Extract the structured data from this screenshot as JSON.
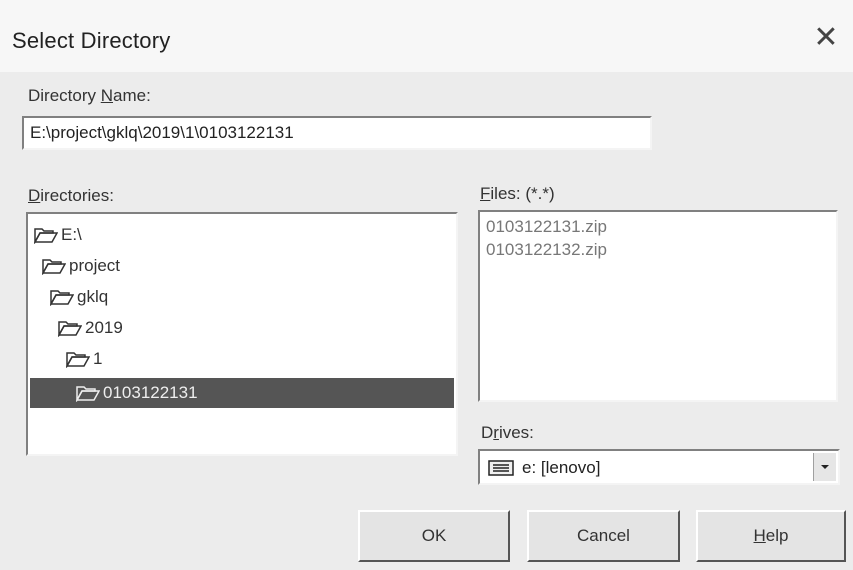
{
  "window": {
    "title": "Select Directory",
    "close_glyph": "✕"
  },
  "directory_name": {
    "label_prefix": "Directory ",
    "label_access": "N",
    "label_rest": "ame:",
    "value": "E:\\project\\gklq\\2019\\1\\0103122131"
  },
  "directories": {
    "label_access": "D",
    "label_rest": "irectories:",
    "items": [
      {
        "name": "E:\\",
        "icon": "folder-open-icon"
      },
      {
        "name": "project",
        "icon": "folder-open-icon"
      },
      {
        "name": "gklq",
        "icon": "folder-open-icon"
      },
      {
        "name": "2019",
        "icon": "folder-open-icon"
      },
      {
        "name": "1",
        "icon": "folder-open-icon"
      },
      {
        "name": "0103122131",
        "icon": "folder-open-icon",
        "selected": true
      }
    ]
  },
  "files": {
    "label_access": "F",
    "label_rest": "iles: (*.*)",
    "items": [
      "0103122131.zip",
      "0103122132.zip"
    ]
  },
  "drives": {
    "label_prefix": "D",
    "label_access": "r",
    "label_rest": "ives:",
    "selected": "e: [lenovo]",
    "icon": "drive-icon"
  },
  "buttons": {
    "ok": "OK",
    "cancel": "Cancel",
    "help_access": "H",
    "help_rest": "elp"
  },
  "colors": {
    "selection_bg": "#555555",
    "window_bg": "#ececec",
    "title_bg": "#f7f7f7"
  }
}
